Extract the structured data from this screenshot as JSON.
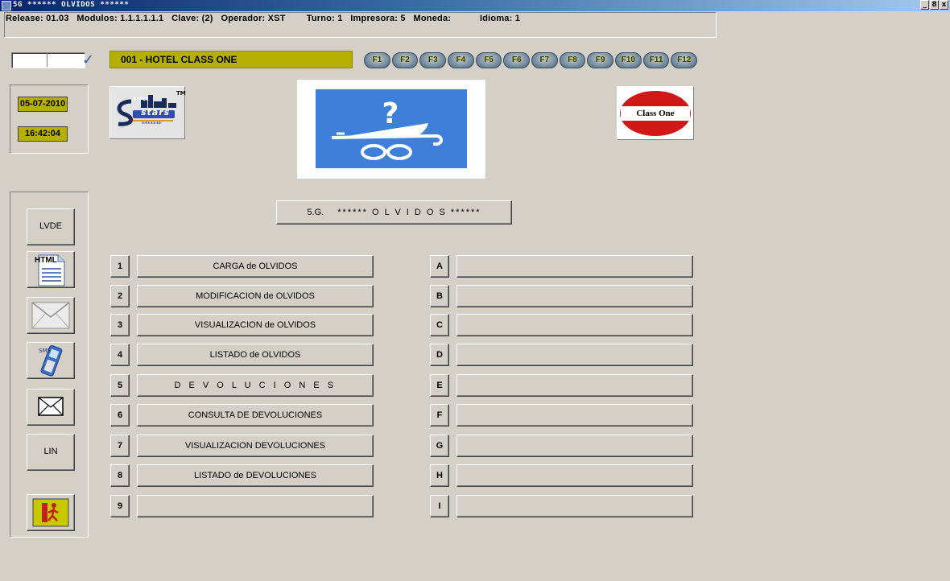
{
  "window": {
    "title": "5G ****** OLVIDOS ******",
    "controls": [
      "_",
      "8",
      "x"
    ]
  },
  "info_bar": {
    "release": "Release: 01.03",
    "modulos": "Modulos: 1.1.1.1.1.1",
    "clave": "Clave:   (2)",
    "operador": "Operador: XST",
    "turno": "Turno:   1",
    "impresora": "Impresora: 5",
    "moneda": "Moneda:",
    "idioma": "Idioma:   1"
  },
  "hotel": {
    "name": "001 - HOTEL CLASS ONE"
  },
  "code_input": {
    "value": ""
  },
  "fkeys": [
    "F1",
    "F2",
    "F3",
    "F4",
    "F5",
    "F6",
    "F7",
    "F8",
    "F9",
    "F10",
    "F11",
    "F12"
  ],
  "datetime": {
    "date": "05-07-2010",
    "time": "16:42:04"
  },
  "logos": {
    "stars_text": "stars",
    "stars_small": "SUPER",
    "stars_tm": "TM",
    "stars_dots": "*******",
    "class_one": "Class One"
  },
  "side": {
    "lvde": "LVDE",
    "html": "HTML",
    "lin": "LIN"
  },
  "module_title": {
    "code": "5.G.",
    "name": "****** O L V I D O S ******"
  },
  "left_menu": [
    {
      "key": "1",
      "label": "CARGA de OLVIDOS"
    },
    {
      "key": "2",
      "label": "MODIFICACION de OLVIDOS"
    },
    {
      "key": "3",
      "label": "VISUALIZACION de OLVIDOS"
    },
    {
      "key": "4",
      "label": "LISTADO de OLVIDOS"
    },
    {
      "key": "5",
      "label": "D E V O L U C I O N E S"
    },
    {
      "key": "6",
      "label": "CONSULTA DE DEVOLUCIONES"
    },
    {
      "key": "7",
      "label": "VISUALIZACION DEVOLUCIONES"
    },
    {
      "key": "8",
      "label": "LISTADO de DEVOLUCIONES"
    },
    {
      "key": "9",
      "label": ""
    }
  ],
  "right_menu": [
    {
      "key": "A",
      "label": ""
    },
    {
      "key": "B",
      "label": ""
    },
    {
      "key": "C",
      "label": ""
    },
    {
      "key": "D",
      "label": ""
    },
    {
      "key": "E",
      "label": ""
    },
    {
      "key": "F",
      "label": ""
    },
    {
      "key": "G",
      "label": ""
    },
    {
      "key": "H",
      "label": ""
    },
    {
      "key": "I",
      "label": ""
    }
  ],
  "colors": {
    "background": "#d4d0c8",
    "accent_yellow": "#b5b000",
    "title_bar": "#0a246a",
    "banner_blue": "#3d7fd9"
  }
}
